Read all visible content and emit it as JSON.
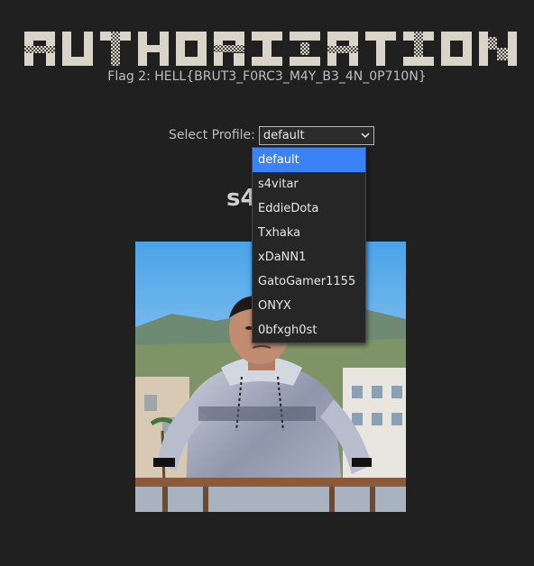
{
  "header": {
    "logo_text": "AUTHORIZATION",
    "flag_text": "Flag 2: HELL{BRUT3_F0RC3_M4Y_B3_4N_0P710N}"
  },
  "profile_selector": {
    "label": "Select Profile:",
    "selected_value": "default",
    "options": [
      "default",
      "s4vitar",
      "EddieDota",
      "Txhaka",
      "xDaNN1",
      "GatoGamer1155",
      "ONYX",
      "0bfxgh0st"
    ]
  },
  "profile": {
    "name": "s4vitar"
  },
  "colors": {
    "background": "#202020",
    "highlight": "#3b82f6",
    "logo": "#d8d4c8"
  }
}
